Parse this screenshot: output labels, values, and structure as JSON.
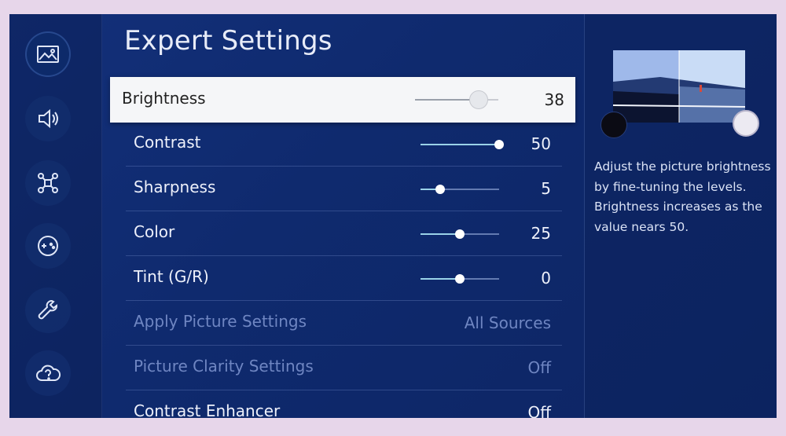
{
  "header": {
    "title": "Expert Settings"
  },
  "sidebar": {
    "items": [
      {
        "icon": "picture-icon",
        "active": true
      },
      {
        "icon": "sound-icon",
        "active": false
      },
      {
        "icon": "connection-icon",
        "active": false
      },
      {
        "icon": "game-controller-icon",
        "active": false
      },
      {
        "icon": "wrench-icon",
        "active": false
      },
      {
        "icon": "help-cloud-icon",
        "active": false
      }
    ]
  },
  "settings": {
    "brightness": {
      "label": "Brightness",
      "value": "38",
      "slider_max": 50
    },
    "contrast": {
      "label": "Contrast",
      "value": "50",
      "slider_max": 50
    },
    "sharpness": {
      "label": "Sharpness",
      "value": "5",
      "slider_max": 20
    },
    "color": {
      "label": "Color",
      "value": "25",
      "slider_max": 50
    },
    "tint": {
      "label": "Tint (G/R)",
      "value": "0",
      "slider_min": -50,
      "slider_max": 50
    },
    "apply_picture": {
      "label": "Apply Picture Settings",
      "value": "All Sources"
    },
    "picture_clarity": {
      "label": "Picture Clarity Settings",
      "value": "Off"
    },
    "contrast_enhancer": {
      "label": "Contrast Enhancer",
      "value": "Off"
    }
  },
  "info": {
    "description": "Adjust the picture brightness by fine-tuning the levels. Brightness increases as the value nears 50."
  },
  "colors": {
    "background": "#13307a",
    "focus_row": "#f5f6f8",
    "slider_fill": "#9ad2e8",
    "disabled_text": "#6f86c2"
  }
}
